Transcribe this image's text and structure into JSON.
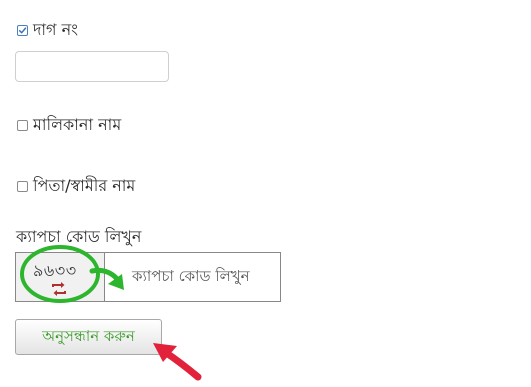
{
  "filters": {
    "dag": {
      "label": "দাগ নং",
      "checked": true,
      "value": ""
    },
    "malikana": {
      "label": "মালিকানা নাম",
      "checked": false
    },
    "pita": {
      "label": "পিতা/স্বামীর নাম",
      "checked": false
    }
  },
  "captcha": {
    "label": "ক্যাপচা কোড লিখুন",
    "code": "৯৬৩৩",
    "placeholder": "ক্যাপচা কোড লিখুন"
  },
  "search_button": {
    "label": "অনুসন্ধান করুন"
  },
  "colors": {
    "annotation_green": "#2db52d",
    "annotation_red": "#e2223a",
    "button_text": "#3a9a2a",
    "refresh_icon": "#b03030"
  },
  "icons": {
    "refresh": "refresh-icon",
    "check": "check-icon"
  }
}
